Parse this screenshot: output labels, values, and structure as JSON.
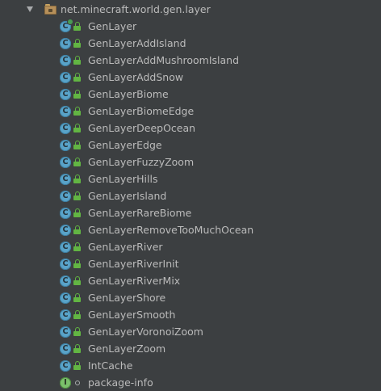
{
  "package": {
    "name": "net.minecraft.world.gen.layer"
  },
  "items": [
    {
      "label": "GenLayer",
      "kind": "class",
      "runnable": true,
      "visibility": "public"
    },
    {
      "label": "GenLayerAddIsland",
      "kind": "class",
      "runnable": false,
      "visibility": "public"
    },
    {
      "label": "GenLayerAddMushroomIsland",
      "kind": "class",
      "runnable": false,
      "visibility": "public"
    },
    {
      "label": "GenLayerAddSnow",
      "kind": "class",
      "runnable": false,
      "visibility": "public"
    },
    {
      "label": "GenLayerBiome",
      "kind": "class",
      "runnable": false,
      "visibility": "public"
    },
    {
      "label": "GenLayerBiomeEdge",
      "kind": "class",
      "runnable": false,
      "visibility": "public"
    },
    {
      "label": "GenLayerDeepOcean",
      "kind": "class",
      "runnable": false,
      "visibility": "public"
    },
    {
      "label": "GenLayerEdge",
      "kind": "class",
      "runnable": false,
      "visibility": "public"
    },
    {
      "label": "GenLayerFuzzyZoom",
      "kind": "class",
      "runnable": false,
      "visibility": "public"
    },
    {
      "label": "GenLayerHills",
      "kind": "class",
      "runnable": false,
      "visibility": "public"
    },
    {
      "label": "GenLayerIsland",
      "kind": "class",
      "runnable": false,
      "visibility": "public"
    },
    {
      "label": "GenLayerRareBiome",
      "kind": "class",
      "runnable": false,
      "visibility": "public"
    },
    {
      "label": "GenLayerRemoveTooMuchOcean",
      "kind": "class",
      "runnable": false,
      "visibility": "public"
    },
    {
      "label": "GenLayerRiver",
      "kind": "class",
      "runnable": false,
      "visibility": "public"
    },
    {
      "label": "GenLayerRiverInit",
      "kind": "class",
      "runnable": false,
      "visibility": "public"
    },
    {
      "label": "GenLayerRiverMix",
      "kind": "class",
      "runnable": false,
      "visibility": "public"
    },
    {
      "label": "GenLayerShore",
      "kind": "class",
      "runnable": false,
      "visibility": "public"
    },
    {
      "label": "GenLayerSmooth",
      "kind": "class",
      "runnable": false,
      "visibility": "public"
    },
    {
      "label": "GenLayerVoronoiZoom",
      "kind": "class",
      "runnable": false,
      "visibility": "public"
    },
    {
      "label": "GenLayerZoom",
      "kind": "class",
      "runnable": false,
      "visibility": "public"
    },
    {
      "label": "IntCache",
      "kind": "class",
      "runnable": false,
      "visibility": "public"
    },
    {
      "label": "package-info",
      "kind": "interface",
      "runnable": false,
      "visibility": "package"
    }
  ],
  "icons": {
    "expand": "chevron-down-icon",
    "package": "package-folder-icon",
    "class": "class-icon",
    "interface": "interface-icon",
    "public": "lock-icon",
    "package_private": "package-private-icon"
  },
  "colors": {
    "background": "#3c3f41",
    "text": "#bbbbbb",
    "class_icon": "#59a3c8",
    "interface_icon": "#7bc06b",
    "visibility_public": "#62b543"
  }
}
